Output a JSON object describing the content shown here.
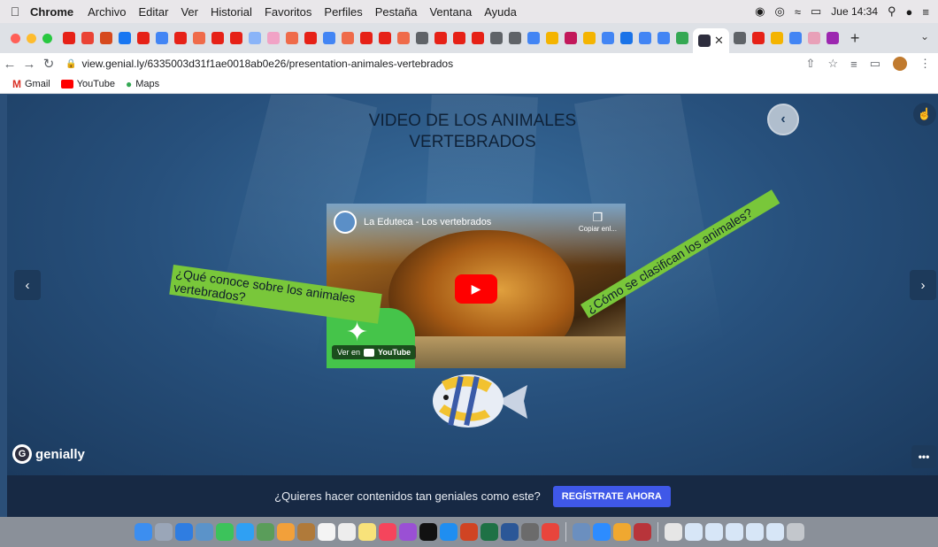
{
  "menubar": {
    "app": "Chrome",
    "items": [
      "Archivo",
      "Editar",
      "Ver",
      "Historial",
      "Favoritos",
      "Perfiles",
      "Pestaña",
      "Ventana",
      "Ayuda"
    ],
    "clock": "Jue 14:34"
  },
  "browser": {
    "url": "view.genial.ly/6335003d31f1ae0018ab0e26/presentation-animales-vertebrados",
    "bookmarks": [
      "Gmail",
      "YouTube",
      "Maps"
    ]
  },
  "slide": {
    "title_line1": "VIDEO DE LOS ANIMALES",
    "title_line2": "VERTEBRADOS",
    "note_left": "¿Qué conoce sobre los animales vertebrados?",
    "note_right": "¿Cómo se clasifican los animales?",
    "brand": "genially"
  },
  "video": {
    "channel_title": "La Eduteca - Los vertebrados",
    "copy_label": "Copiar enl...",
    "watch_on": "Ver en",
    "watch_brand": "YouTube"
  },
  "banner": {
    "text": "¿Quieres hacer contenidos tan geniales como este?",
    "cta": "REGÍSTRATE AHORA"
  },
  "colors": {
    "stage": "#2b4f78",
    "note": "#79c73a",
    "cta": "#3f58e8",
    "banner": "#172944"
  }
}
